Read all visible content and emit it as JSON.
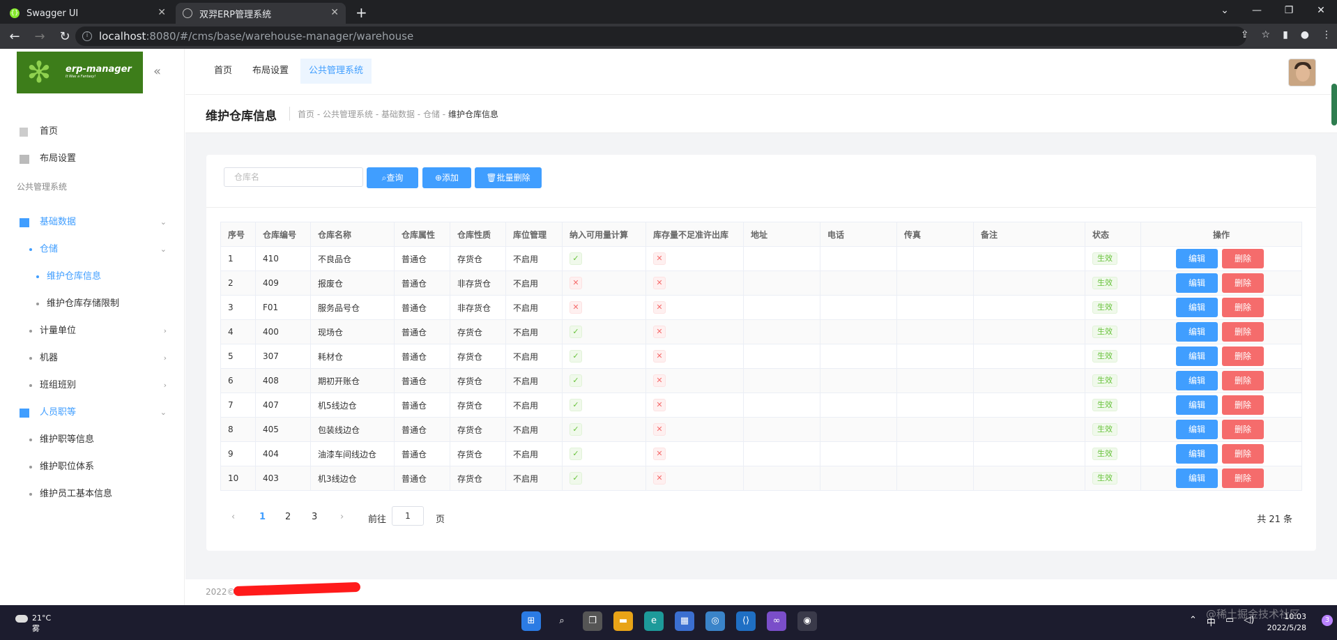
{
  "browser": {
    "tabs": [
      {
        "title": "Swagger UI",
        "icon": "swagger-icon"
      },
      {
        "title": "双羿ERP管理系统",
        "icon": "globe-icon"
      }
    ],
    "url_host": "localhost",
    "url_rest": ":8080/#/cms/base/warehouse-manager/warehouse"
  },
  "sidebar": {
    "logo_text": "erp-manager",
    "logo_sub": "It Was a Fantasy!",
    "top_items": [
      {
        "label": "首页",
        "icon": "dashboard-icon"
      },
      {
        "label": "布局设置",
        "icon": "layout-icon"
      }
    ],
    "group_title": "公共管理系统",
    "menu": [
      {
        "label": "基础数据",
        "level": 1,
        "active": true,
        "arrow": "⌄"
      },
      {
        "label": "仓储",
        "level": 2,
        "active": true,
        "arrow": "⌄"
      },
      {
        "label": "维护仓库信息",
        "level": 3,
        "active": true
      },
      {
        "label": "维护仓库存储限制",
        "level": 3,
        "active": false
      },
      {
        "label": "计量单位",
        "level": 2,
        "active": false,
        "arrow": "›"
      },
      {
        "label": "机器",
        "level": 2,
        "active": false,
        "arrow": "›"
      },
      {
        "label": "班组班别",
        "level": 2,
        "active": false,
        "arrow": "›"
      },
      {
        "label": "人员职等",
        "level": 1,
        "active": true,
        "arrow": "⌄"
      },
      {
        "label": "维护职等信息",
        "level": 2,
        "active": false
      },
      {
        "label": "维护职位体系",
        "level": 2,
        "active": false
      },
      {
        "label": "维护员工基本信息",
        "level": 2,
        "active": false
      }
    ]
  },
  "topnav": [
    {
      "label": "首页",
      "active": false
    },
    {
      "label": "布局设置",
      "active": false
    },
    {
      "label": "公共管理系统",
      "active": true
    }
  ],
  "page": {
    "title": "维护仓库信息",
    "breadcrumb": [
      "首页",
      "公共管理系统",
      "基础数据",
      "仓储",
      "维护仓库信息"
    ]
  },
  "toolbar": {
    "search_placeholder": "仓库名",
    "query_label": "查询",
    "add_label": "添加",
    "batch_delete_label": "批量删除"
  },
  "table": {
    "headers": [
      "序号",
      "仓库编号",
      "仓库名称",
      "仓库属性",
      "仓库性质",
      "库位管理",
      "纳入可用量计算",
      "库存量不足准许出库",
      "地址",
      "电话",
      "传真",
      "备注",
      "状态",
      "操作"
    ],
    "rows": [
      {
        "no": "1",
        "code": "410",
        "name": "不良品仓",
        "attr": "普通仓",
        "nature": "存货仓",
        "loc": "不启用",
        "avail": true,
        "allow": false,
        "status": "生效"
      },
      {
        "no": "2",
        "code": "409",
        "name": "报废仓",
        "attr": "普通仓",
        "nature": "非存货仓",
        "loc": "不启用",
        "avail": false,
        "allow": false,
        "status": "生效"
      },
      {
        "no": "3",
        "code": "F01",
        "name": "服务品号仓",
        "attr": "普通仓",
        "nature": "非存货仓",
        "loc": "不启用",
        "avail": false,
        "allow": false,
        "status": "生效"
      },
      {
        "no": "4",
        "code": "400",
        "name": "现场仓",
        "attr": "普通仓",
        "nature": "存货仓",
        "loc": "不启用",
        "avail": true,
        "allow": false,
        "status": "生效"
      },
      {
        "no": "5",
        "code": "307",
        "name": "耗材仓",
        "attr": "普通仓",
        "nature": "存货仓",
        "loc": "不启用",
        "avail": true,
        "allow": false,
        "status": "生效"
      },
      {
        "no": "6",
        "code": "408",
        "name": "期初开账仓",
        "attr": "普通仓",
        "nature": "存货仓",
        "loc": "不启用",
        "avail": true,
        "allow": false,
        "status": "生效"
      },
      {
        "no": "7",
        "code": "407",
        "name": "机5线边仓",
        "attr": "普通仓",
        "nature": "存货仓",
        "loc": "不启用",
        "avail": true,
        "allow": false,
        "status": "生效"
      },
      {
        "no": "8",
        "code": "405",
        "name": "包装线边仓",
        "attr": "普通仓",
        "nature": "存货仓",
        "loc": "不启用",
        "avail": true,
        "allow": false,
        "status": "生效"
      },
      {
        "no": "9",
        "code": "404",
        "name": "油漆车间线边仓",
        "attr": "普通仓",
        "nature": "存货仓",
        "loc": "不启用",
        "avail": true,
        "allow": false,
        "status": "生效"
      },
      {
        "no": "10",
        "code": "403",
        "name": "机3线边仓",
        "attr": "普通仓",
        "nature": "存货仓",
        "loc": "不启用",
        "avail": true,
        "allow": false,
        "status": "生效"
      }
    ],
    "edit_label": "编辑",
    "delete_label": "删除"
  },
  "pagination": {
    "pages": [
      "1",
      "2",
      "3"
    ],
    "current": "1",
    "goto_prefix": "前往",
    "goto_value": "1",
    "goto_suffix": "页",
    "total": "共 21 条"
  },
  "footer": {
    "text": "2022©"
  },
  "taskbar": {
    "temp": "21°C",
    "weather": "雾",
    "time": "10:03",
    "date": "2022/5/28",
    "ime": "中",
    "notifications": "3",
    "watermark": "@稀土掘金技术社区"
  },
  "colors": {
    "primary": "#409eff",
    "danger": "#f56c6c",
    "success": "#67c23a",
    "logo_bg": "#3d7d1a"
  }
}
